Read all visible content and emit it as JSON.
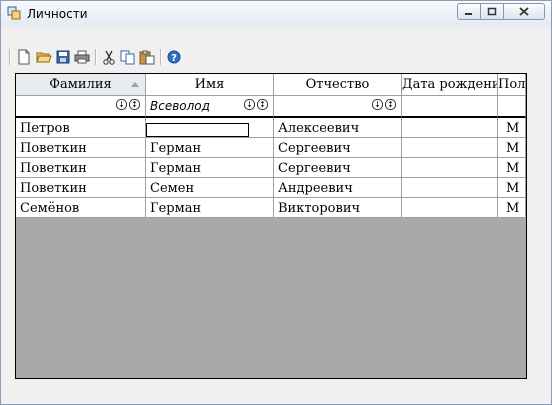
{
  "window": {
    "title": "Личности"
  },
  "toolbar": {
    "buttons": [
      "new-icon",
      "open-icon",
      "save-icon",
      "print-icon",
      "cut-icon",
      "copy-icon",
      "paste-icon",
      "help-icon"
    ]
  },
  "grid": {
    "columns": [
      "Фамилия",
      "Имя",
      "Отчество",
      "Дата рождения",
      "Пол"
    ],
    "filter": {
      "name_value": "Всеволод"
    },
    "rows": [
      [
        "Петров",
        "",
        "Алексеевич",
        "",
        "М"
      ],
      [
        "Поветкин",
        "Герман",
        "Сергеевич",
        "",
        "М"
      ],
      [
        "Поветкин",
        "Герман",
        "Сергеевич",
        "",
        "М"
      ],
      [
        "Поветкин",
        "Семен",
        "Андреевич",
        "",
        "М"
      ],
      [
        "Семёнов",
        "Герман",
        "Викторович",
        "",
        "М"
      ]
    ]
  },
  "colors": {
    "grid_empty_bg": "#a9a9a9",
    "title_text": "#000000"
  }
}
